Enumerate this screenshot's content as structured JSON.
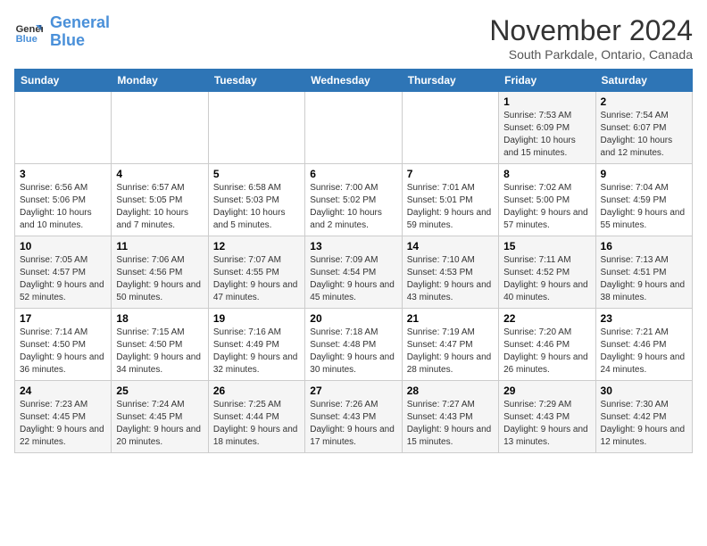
{
  "logo": {
    "line1": "General",
    "line2": "Blue"
  },
  "title": "November 2024",
  "subtitle": "South Parkdale, Ontario, Canada",
  "days_of_week": [
    "Sunday",
    "Monday",
    "Tuesday",
    "Wednesday",
    "Thursday",
    "Friday",
    "Saturday"
  ],
  "weeks": [
    [
      {
        "day": "",
        "info": ""
      },
      {
        "day": "",
        "info": ""
      },
      {
        "day": "",
        "info": ""
      },
      {
        "day": "",
        "info": ""
      },
      {
        "day": "",
        "info": ""
      },
      {
        "day": "1",
        "info": "Sunrise: 7:53 AM\nSunset: 6:09 PM\nDaylight: 10 hours and 15 minutes."
      },
      {
        "day": "2",
        "info": "Sunrise: 7:54 AM\nSunset: 6:07 PM\nDaylight: 10 hours and 12 minutes."
      }
    ],
    [
      {
        "day": "3",
        "info": "Sunrise: 6:56 AM\nSunset: 5:06 PM\nDaylight: 10 hours and 10 minutes."
      },
      {
        "day": "4",
        "info": "Sunrise: 6:57 AM\nSunset: 5:05 PM\nDaylight: 10 hours and 7 minutes."
      },
      {
        "day": "5",
        "info": "Sunrise: 6:58 AM\nSunset: 5:03 PM\nDaylight: 10 hours and 5 minutes."
      },
      {
        "day": "6",
        "info": "Sunrise: 7:00 AM\nSunset: 5:02 PM\nDaylight: 10 hours and 2 minutes."
      },
      {
        "day": "7",
        "info": "Sunrise: 7:01 AM\nSunset: 5:01 PM\nDaylight: 9 hours and 59 minutes."
      },
      {
        "day": "8",
        "info": "Sunrise: 7:02 AM\nSunset: 5:00 PM\nDaylight: 9 hours and 57 minutes."
      },
      {
        "day": "9",
        "info": "Sunrise: 7:04 AM\nSunset: 4:59 PM\nDaylight: 9 hours and 55 minutes."
      }
    ],
    [
      {
        "day": "10",
        "info": "Sunrise: 7:05 AM\nSunset: 4:57 PM\nDaylight: 9 hours and 52 minutes."
      },
      {
        "day": "11",
        "info": "Sunrise: 7:06 AM\nSunset: 4:56 PM\nDaylight: 9 hours and 50 minutes."
      },
      {
        "day": "12",
        "info": "Sunrise: 7:07 AM\nSunset: 4:55 PM\nDaylight: 9 hours and 47 minutes."
      },
      {
        "day": "13",
        "info": "Sunrise: 7:09 AM\nSunset: 4:54 PM\nDaylight: 9 hours and 45 minutes."
      },
      {
        "day": "14",
        "info": "Sunrise: 7:10 AM\nSunset: 4:53 PM\nDaylight: 9 hours and 43 minutes."
      },
      {
        "day": "15",
        "info": "Sunrise: 7:11 AM\nSunset: 4:52 PM\nDaylight: 9 hours and 40 minutes."
      },
      {
        "day": "16",
        "info": "Sunrise: 7:13 AM\nSunset: 4:51 PM\nDaylight: 9 hours and 38 minutes."
      }
    ],
    [
      {
        "day": "17",
        "info": "Sunrise: 7:14 AM\nSunset: 4:50 PM\nDaylight: 9 hours and 36 minutes."
      },
      {
        "day": "18",
        "info": "Sunrise: 7:15 AM\nSunset: 4:50 PM\nDaylight: 9 hours and 34 minutes."
      },
      {
        "day": "19",
        "info": "Sunrise: 7:16 AM\nSunset: 4:49 PM\nDaylight: 9 hours and 32 minutes."
      },
      {
        "day": "20",
        "info": "Sunrise: 7:18 AM\nSunset: 4:48 PM\nDaylight: 9 hours and 30 minutes."
      },
      {
        "day": "21",
        "info": "Sunrise: 7:19 AM\nSunset: 4:47 PM\nDaylight: 9 hours and 28 minutes."
      },
      {
        "day": "22",
        "info": "Sunrise: 7:20 AM\nSunset: 4:46 PM\nDaylight: 9 hours and 26 minutes."
      },
      {
        "day": "23",
        "info": "Sunrise: 7:21 AM\nSunset: 4:46 PM\nDaylight: 9 hours and 24 minutes."
      }
    ],
    [
      {
        "day": "24",
        "info": "Sunrise: 7:23 AM\nSunset: 4:45 PM\nDaylight: 9 hours and 22 minutes."
      },
      {
        "day": "25",
        "info": "Sunrise: 7:24 AM\nSunset: 4:45 PM\nDaylight: 9 hours and 20 minutes."
      },
      {
        "day": "26",
        "info": "Sunrise: 7:25 AM\nSunset: 4:44 PM\nDaylight: 9 hours and 18 minutes."
      },
      {
        "day": "27",
        "info": "Sunrise: 7:26 AM\nSunset: 4:43 PM\nDaylight: 9 hours and 17 minutes."
      },
      {
        "day": "28",
        "info": "Sunrise: 7:27 AM\nSunset: 4:43 PM\nDaylight: 9 hours and 15 minutes."
      },
      {
        "day": "29",
        "info": "Sunrise: 7:29 AM\nSunset: 4:43 PM\nDaylight: 9 hours and 13 minutes."
      },
      {
        "day": "30",
        "info": "Sunrise: 7:30 AM\nSunset: 4:42 PM\nDaylight: 9 hours and 12 minutes."
      }
    ]
  ]
}
